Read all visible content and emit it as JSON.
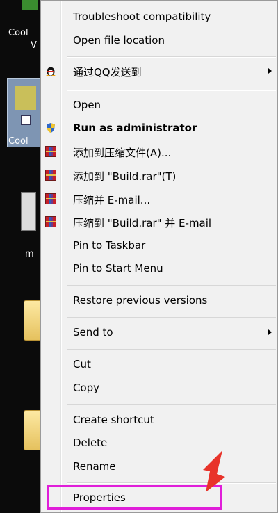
{
  "desktop": {
    "label_1a": "Cool",
    "label_1b": "V",
    "label_2": "Cool",
    "label_3": "m"
  },
  "menu": {
    "items": [
      {
        "label": "Troubleshoot compatibility",
        "icon": ""
      },
      {
        "label": "Open file location",
        "icon": ""
      },
      {
        "label": "通过QQ发送到",
        "icon": "qq-penguin-icon",
        "submenu": true
      },
      {
        "label": "Open",
        "icon": ""
      },
      {
        "label": "Run as administrator",
        "icon": "uac-shield-icon",
        "bold": true
      },
      {
        "label": "添加到压缩文件(A)...",
        "icon": "winrar-icon"
      },
      {
        "label": "添加到 \"Build.rar\"(T)",
        "icon": "winrar-icon"
      },
      {
        "label": "压缩并 E-mail...",
        "icon": "winrar-icon"
      },
      {
        "label": "压缩到 \"Build.rar\" 并 E-mail",
        "icon": "winrar-icon"
      },
      {
        "label": "Pin to Taskbar",
        "icon": ""
      },
      {
        "label": "Pin to Start Menu",
        "icon": ""
      },
      {
        "label": "Restore previous versions",
        "icon": ""
      },
      {
        "label": "Send to",
        "icon": "",
        "submenu": true
      },
      {
        "label": "Cut",
        "icon": ""
      },
      {
        "label": "Copy",
        "icon": ""
      },
      {
        "label": "Create shortcut",
        "icon": ""
      },
      {
        "label": "Delete",
        "icon": ""
      },
      {
        "label": "Rename",
        "icon": ""
      },
      {
        "label": "Properties",
        "icon": ""
      }
    ]
  },
  "annotation": {
    "highlight_color": "#e01ed9",
    "arrow_color": "#e8332a",
    "highlighted_item": "Properties"
  }
}
